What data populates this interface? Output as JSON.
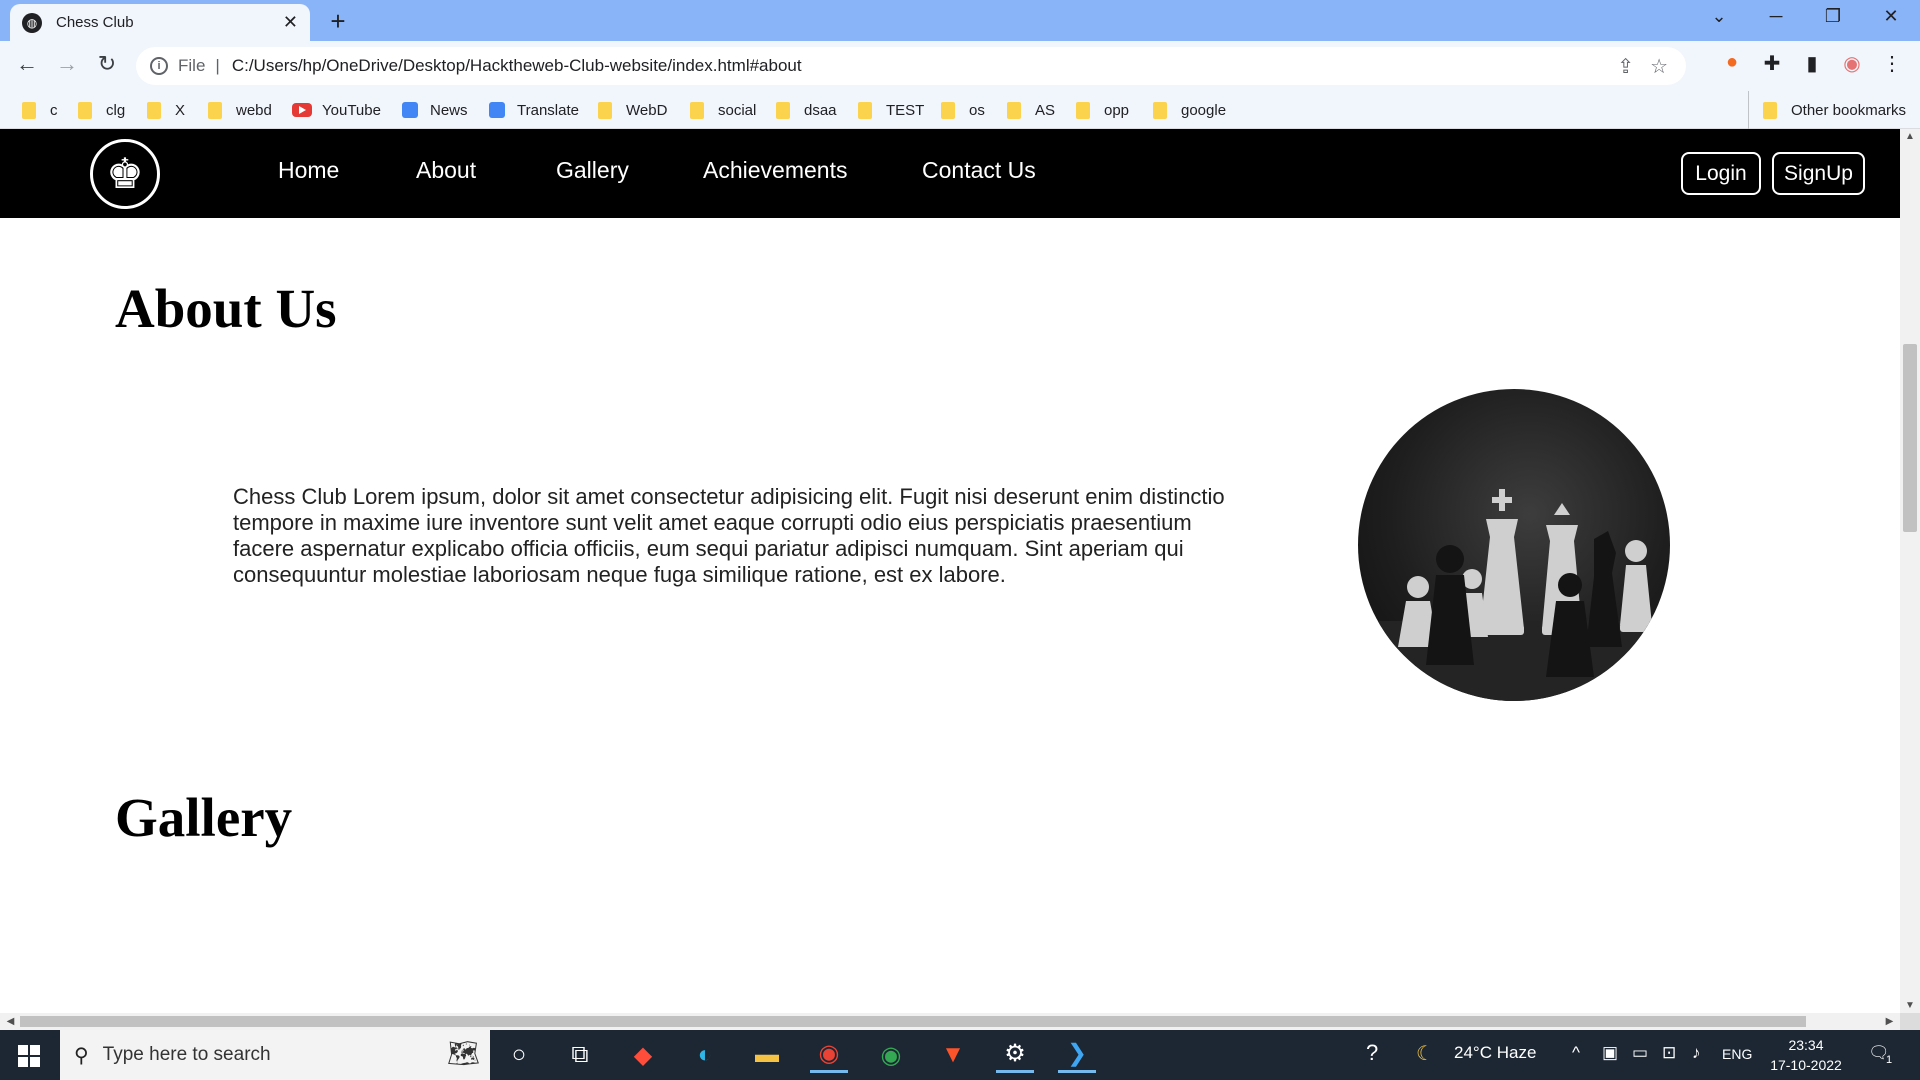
{
  "browser": {
    "tab_title": "Chess Club",
    "tab_close": "✕",
    "new_tab": "+",
    "url_prefix": "File",
    "url": "C:/Users/hp/OneDrive/Desktop/Hacktheweb-Club-website/index.html#about",
    "bookmarks": [
      "c",
      "clg",
      "X",
      "webd",
      "YouTube",
      "News",
      "Translate",
      "WebD",
      "social",
      "dsaa",
      "TEST",
      "os",
      "AS",
      "opp",
      "google"
    ],
    "other_bookmarks": "Other bookmarks"
  },
  "site": {
    "nav": [
      "Home",
      "About",
      "Gallery",
      "Achievements",
      "Contact Us"
    ],
    "login": "Login",
    "signup": "SignUp",
    "about_heading": "About Us",
    "about_text": "Chess Club Lorem ipsum, dolor sit amet consectetur adipisicing elit. Fugit nisi deserunt enim distinctio tempore in maxime iure inventore sunt velit amet eaque corrupti odio eius perspiciatis praesentium facere aspernatur explicabo officia officiis, eum sequi pariatur adipisci numquam. Sint aperiam qui consequuntur molestiae laboriosam neque fuga similique ratione, est ex labore.",
    "gallery_heading": "Gallery"
  },
  "taskbar": {
    "search_placeholder": "Type here to search",
    "weather": "24°C  Haze",
    "language": "ENG",
    "time": "23:34",
    "date": "17-10-2022",
    "notifications": "1"
  },
  "colors": {
    "tabstrip": "#8ab4f8",
    "toolbar": "#f1f5fc",
    "navbar": "#000000",
    "taskbar": "#1c2733"
  }
}
